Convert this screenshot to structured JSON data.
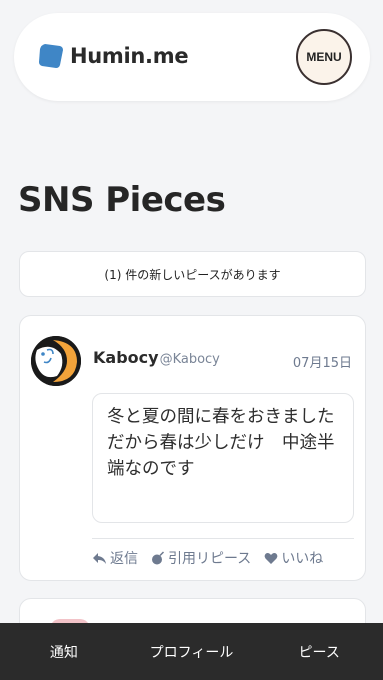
{
  "header": {
    "logo_text": "Humin.me",
    "menu_label": "MENU",
    "brand_color": "#3f86c6"
  },
  "page": {
    "title": "SNS Pieces"
  },
  "notice": {
    "text": "(1) 件の新しいピースがあります"
  },
  "post": {
    "user_name": "Kabocy",
    "user_handle": "@Kabocy",
    "date": "07月15日",
    "body": "冬と夏の間に春をおきました\nだから春は少しだけ　中途半端なのです",
    "actions": {
      "reply": "返信",
      "quote": "引用リピース",
      "like": "いいね"
    }
  },
  "bottom_nav": {
    "items": [
      "通知",
      "プロフィール",
      "ピース"
    ]
  }
}
